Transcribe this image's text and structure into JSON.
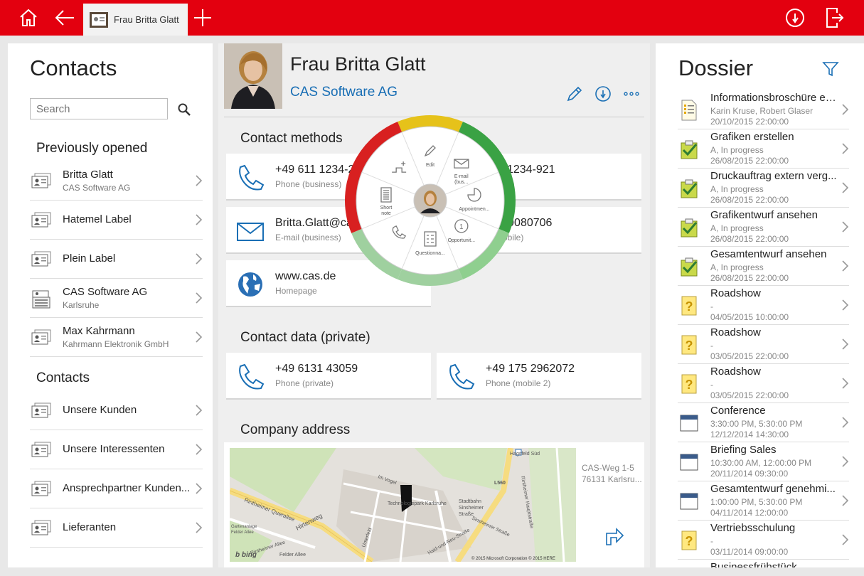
{
  "tab": {
    "label": "Frau Britta Glatt"
  },
  "colors": {
    "brand": "#e3000f",
    "link": "#1a6fb5"
  },
  "left": {
    "title": "Contacts",
    "search_placeholder": "Search",
    "previously_opened_heading": "Previously opened",
    "recent": [
      {
        "title": "Britta Glatt",
        "sub": "CAS Software AG",
        "icon": "contact-card-icon"
      },
      {
        "title": "Hatemel Label",
        "sub": "",
        "icon": "contact-card-icon"
      },
      {
        "title": "Plein Label",
        "sub": "",
        "icon": "contact-card-icon"
      },
      {
        "title": "CAS Software AG",
        "sub": "Karlsruhe",
        "icon": "company-icon"
      },
      {
        "title": "Max Kahrmann",
        "sub": "Kahrmann Elektronik GmbH",
        "icon": "contact-card-icon"
      }
    ],
    "contacts_heading": "Contacts",
    "groups": [
      {
        "title": "Unsere Kunden"
      },
      {
        "title": "Unsere Interessenten"
      },
      {
        "title": "Ansprechpartner Kunden..."
      },
      {
        "title": "Lieferanten"
      }
    ]
  },
  "middle": {
    "name": "Frau Britta Glatt",
    "company": "CAS Software AG",
    "contact_methods_heading": "Contact methods",
    "contact_methods": [
      {
        "value": "+49 611 1234-2",
        "label": "Phone (business)",
        "icon": "phone-icon"
      },
      {
        "value": "611 1234-921",
        "label": "isiness)",
        "icon": "phone-icon"
      },
      {
        "value": "Britta.Glatt@ca",
        "label": "E-mail (business)",
        "icon": "mail-icon"
      },
      {
        "value": "171 9080706",
        "label": "e (mobile)",
        "icon": "mobile-icon"
      },
      {
        "value": "www.cas.de",
        "label": "Homepage",
        "icon": "globe-icon"
      }
    ],
    "private_heading": "Contact data (private)",
    "private": [
      {
        "value": "+49 6131 43059",
        "label": "Phone (private)",
        "icon": "phone-icon"
      },
      {
        "value": "+49 175 2962072",
        "label": "Phone (mobile 2)",
        "icon": "phone-icon"
      }
    ],
    "address_heading": "Company address",
    "address_line1": "CAS-Weg 1-5",
    "address_line2": "76131 Karlsru...",
    "map": {
      "copyright": "© 2015 Microsoft Corporation © 2015 HERE",
      "labels": [
        "Hagsfeld Süd",
        "L560",
        "Im Vogel",
        "Technologiepark Karlsruhe",
        "Stadtbahn",
        "Sinsheimer",
        "Straße",
        "Rintheimer Hauptstraße",
        "Sinsheimer Straße",
        "Rintheimer Querallee",
        "Hirtenweg",
        "Unterfeld",
        "Haid-und-Neu-Straße",
        "Rintheimer Allee",
        "Gartenanlage",
        "Felder Allee",
        "Felder Allee"
      ]
    }
  },
  "radial": {
    "items": [
      {
        "label": "Edit",
        "icon": "pencil-icon"
      },
      {
        "label": "E-mail (bus...",
        "label1": "E-mail",
        "label2": "(bus...",
        "icon": "mail-icon"
      },
      {
        "label": "Appointmen...",
        "icon": "pie-icon"
      },
      {
        "label": "Opportunit...",
        "icon": "opportunity-icon"
      },
      {
        "label": "Questionna...",
        "icon": "questionnaire-icon"
      },
      {
        "label": "",
        "icon": "phone-call-icon"
      },
      {
        "label": "Short note",
        "label1": "Short",
        "label2": "note",
        "icon": "note-icon"
      },
      {
        "label": "",
        "icon": "add-relation-icon"
      }
    ]
  },
  "right": {
    "title": "Dossier",
    "items": [
      {
        "title": "Informationsbroschüre er...",
        "sub": "Karin Kruse, Robert Glaser",
        "date": "20/10/2015 22:00:00",
        "icon": "document-icon"
      },
      {
        "title": "Grafiken erstellen",
        "sub": "A, In progress",
        "date": "26/08/2015 22:00:00",
        "icon": "task-icon"
      },
      {
        "title": "Druckauftrag extern verg...",
        "sub": "A, In progress",
        "date": "26/08/2015 22:00:00",
        "icon": "task-icon"
      },
      {
        "title": "Grafikentwurf ansehen",
        "sub": "A, In progress",
        "date": "26/08/2015 22:00:00",
        "icon": "task-icon"
      },
      {
        "title": "Gesamtentwurf ansehen",
        "sub": "A, In progress",
        "date": "26/08/2015 22:00:00",
        "icon": "task-icon"
      },
      {
        "title": "Roadshow",
        "sub": "-",
        "date": "04/05/2015 10:00:00",
        "icon": "question-icon"
      },
      {
        "title": "Roadshow",
        "sub": "-",
        "date": "03/05/2015 22:00:00",
        "icon": "question-icon"
      },
      {
        "title": "Roadshow",
        "sub": "-",
        "date": "03/05/2015 22:00:00",
        "icon": "question-icon"
      },
      {
        "title": "Conference",
        "sub": "3:30:00 PM, 5:30:00 PM",
        "date": "12/12/2014 14:30:00",
        "icon": "calendar-icon"
      },
      {
        "title": "Briefing Sales",
        "sub": "10:30:00 AM, 12:00:00 PM",
        "date": "20/11/2014 09:30:00",
        "icon": "calendar-icon"
      },
      {
        "title": "Gesamtentwurf genehmi...",
        "sub": "1:00:00 PM, 5:30:00 PM",
        "date": "04/11/2014 12:00:00",
        "icon": "calendar-icon"
      },
      {
        "title": "Vertriebsschulung",
        "sub": "-",
        "date": "03/11/2014 09:00:00",
        "icon": "question-icon"
      },
      {
        "title": "Businessfrühstück",
        "sub": "",
        "date": "",
        "icon": "question-icon"
      }
    ]
  }
}
